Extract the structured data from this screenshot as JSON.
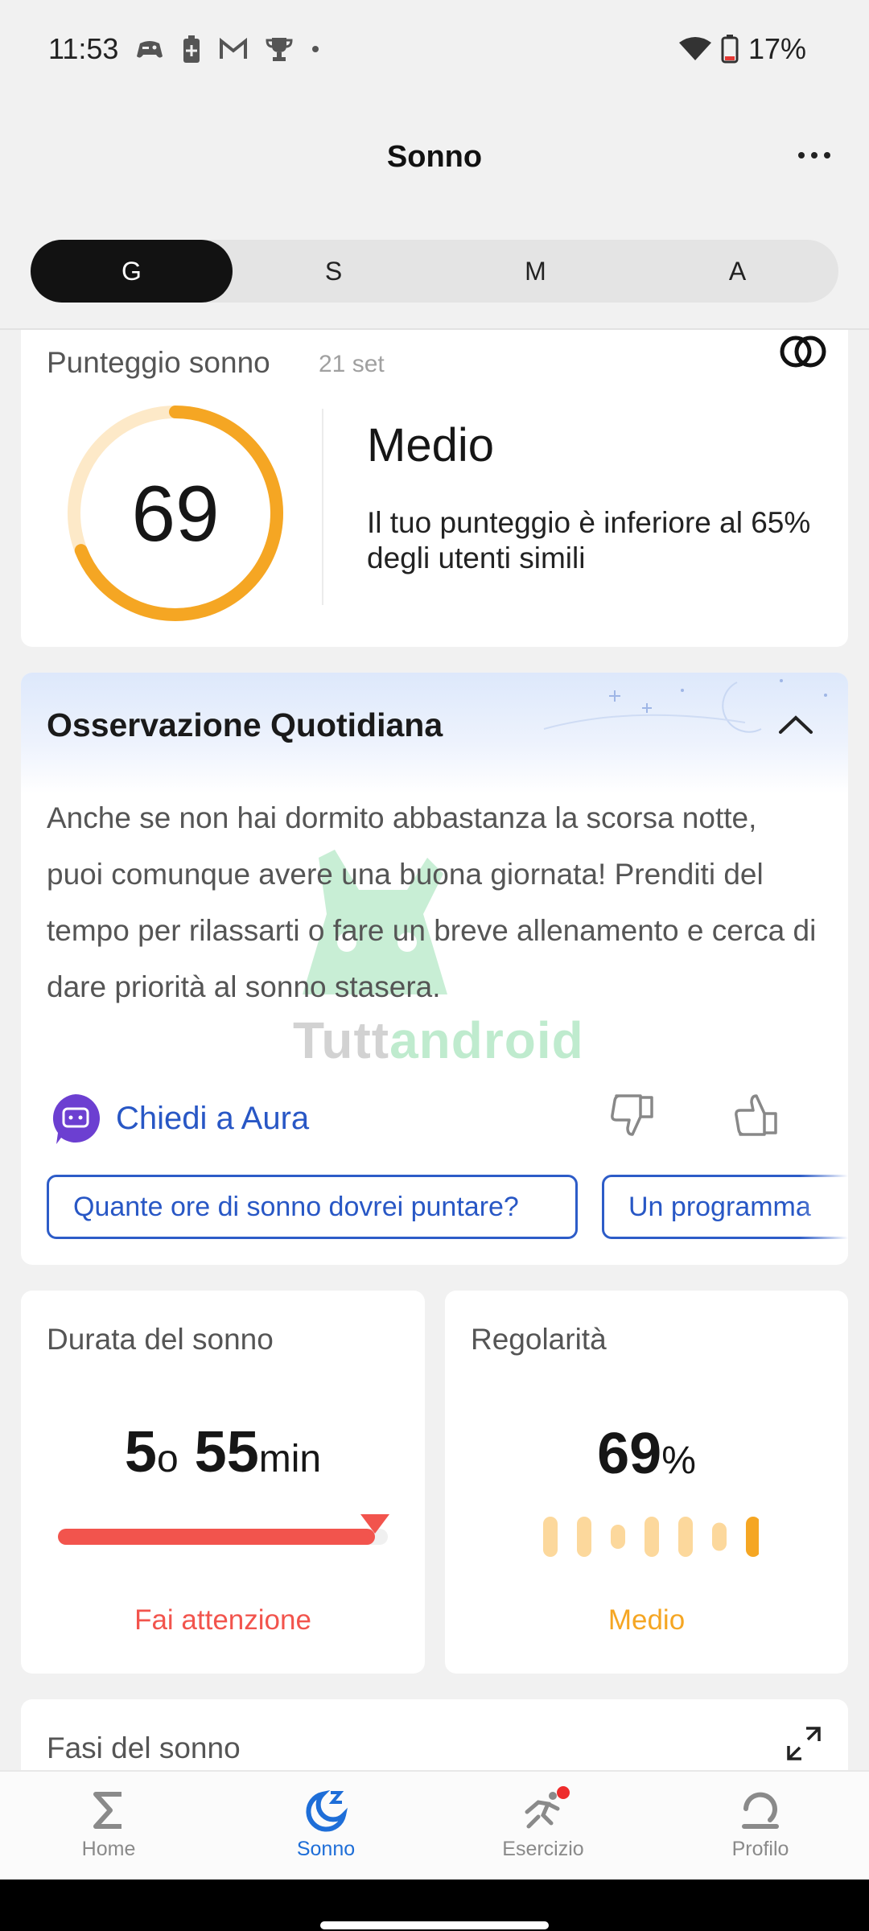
{
  "status_bar": {
    "time": "11:53",
    "battery": "17%",
    "icons": [
      "gamepad-icon",
      "battery-saver-icon",
      "gmail-icon",
      "trophy-icon",
      "dot-icon",
      "wifi-icon",
      "battery-icon"
    ]
  },
  "header": {
    "title": "Sonno",
    "more_icon": "more-horizontal-icon"
  },
  "tabs": [
    {
      "label": "G",
      "active": true
    },
    {
      "label": "S",
      "active": false
    },
    {
      "label": "M",
      "active": false
    },
    {
      "label": "A",
      "active": false
    }
  ],
  "score_card": {
    "title": "Punteggio sonno",
    "date": "21 set",
    "value": "69",
    "score_fraction": 0.69,
    "level": "Medio",
    "description": "Il tuo punteggio è inferiore al 65% degli utenti simili",
    "ring_color": "#f5a623",
    "ring_track_color": "#fde9c8"
  },
  "observation": {
    "title": "Osservazione Quotidiana",
    "text": "Anche se non hai dormito abbastanza la scorsa notte, puoi comunque avere una buona giornata! Prenditi del tempo per rilassarti o fare un breve allenamento e cerca di dare priorità al sonno stasera.",
    "ask_label": "Chiedi a Aura",
    "watermark": "Tuttandroid",
    "watermark_part1": "Tutt",
    "watermark_part2": "android",
    "chips": [
      "Quante ore di sonno dovrei puntare?",
      "Un programma"
    ]
  },
  "duration": {
    "title": "Durata del sonno",
    "hours": "5",
    "hours_unit": "o",
    "minutes": "55",
    "minutes_unit": "min",
    "status": "Fai attenzione",
    "status_color": "#f2544d",
    "fill_fraction": 0.96
  },
  "regularity": {
    "title": "Regolarità",
    "value": "69",
    "unit": "%",
    "status": "Medio",
    "status_color": "#f5a623",
    "bars": [
      {
        "level": 1.0,
        "highlight": false
      },
      {
        "level": 1.0,
        "highlight": false
      },
      {
        "level": 0.6,
        "highlight": false
      },
      {
        "level": 1.0,
        "highlight": false
      },
      {
        "level": 1.0,
        "highlight": false
      },
      {
        "level": 0.7,
        "highlight": false
      },
      {
        "level": 1.0,
        "highlight": true
      }
    ]
  },
  "phases": {
    "title": "Fasi del sonno"
  },
  "bottom_nav": [
    {
      "label": "Home",
      "icon": "sigma-icon",
      "active": false
    },
    {
      "label": "Sonno",
      "icon": "moon-zz-icon",
      "active": true
    },
    {
      "label": "Esercizio",
      "icon": "running-icon",
      "active": false,
      "badge": true
    },
    {
      "label": "Profilo",
      "icon": "profile-icon",
      "active": false
    }
  ]
}
